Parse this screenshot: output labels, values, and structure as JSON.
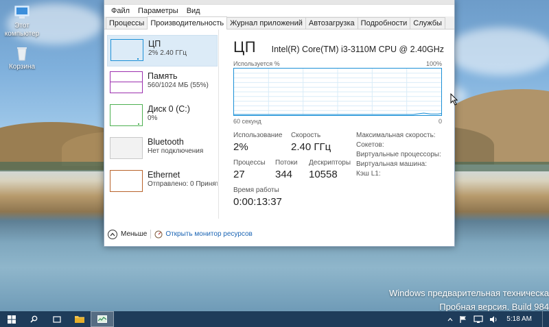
{
  "desktop": {
    "icons": [
      {
        "label": "Этот компьютер",
        "icon": "computer-icon"
      },
      {
        "label": "Корзина",
        "icon": "recycle-bin-icon"
      }
    ],
    "watermark_line1": "Windows предварительная техническа",
    "watermark_line2": "Пробная версия. Build 984"
  },
  "window": {
    "menu": [
      "Файл",
      "Параметры",
      "Вид"
    ],
    "tabs": [
      "Процессы",
      "Производительность",
      "Журнал приложений",
      "Автозагрузка",
      "Подробности",
      "Службы"
    ],
    "selected_tab": "Производительность",
    "resources": [
      {
        "name": "ЦП",
        "sub": "2% 2.40 ГГц",
        "color": "#1a8fd6",
        "selected": true
      },
      {
        "name": "Память",
        "sub": "560/1024 МБ (55%)",
        "color": "#9b2fae",
        "selected": false
      },
      {
        "name": "Диск 0 (C:)",
        "sub": "0%",
        "color": "#4caf50",
        "selected": false
      },
      {
        "name": "Bluetooth",
        "sub": "Нет подключения",
        "color": "#c8c8c8",
        "selected": false
      },
      {
        "name": "Ethernet",
        "sub": "Отправлено: 0 Принят",
        "color": "#b8632a",
        "selected": false
      }
    ],
    "detail": {
      "title": "ЦП",
      "model": "Intel(R) Core(TM) i3-3110M CPU @ 2.40GHz",
      "graph_top_left": "Используется %",
      "graph_top_right": "100%",
      "graph_bottom_left": "60 секунд",
      "graph_bottom_right": "0",
      "usage_label": "Использование",
      "usage_value": "2%",
      "speed_label": "Скорость",
      "speed_value": "2.40 ГГц",
      "processes_label": "Процессы",
      "processes_value": "27",
      "threads_label": "Потоки",
      "threads_value": "344",
      "handles_label": "Дескрипторы",
      "handles_value": "10558",
      "uptime_label": "Время работы",
      "uptime_value": "0:00:13:37",
      "right_labels": [
        "Максимальная скорость:",
        "Сокетов:",
        "Виртуальные процессоры:",
        "Виртуальная машина:",
        "Кэш L1:"
      ],
      "cpu_history": [
        0,
        0,
        0,
        0,
        0,
        0,
        0,
        0,
        0,
        0,
        0,
        0,
        0,
        0,
        0,
        0,
        0,
        0,
        0,
        0,
        0,
        0,
        0,
        0,
        0,
        0,
        0,
        0,
        0,
        0,
        0,
        0,
        0,
        0,
        0,
        0,
        0,
        0,
        0,
        0,
        0,
        0,
        0,
        0,
        0,
        0,
        0,
        0,
        0,
        0,
        0,
        0,
        1,
        2,
        3,
        2,
        1,
        1,
        1,
        2
      ]
    },
    "footer": {
      "less_label": "Меньше",
      "monitor_link": "Открыть монитор ресурсов"
    }
  },
  "taskbar": {
    "clock": "5:18 AM"
  }
}
